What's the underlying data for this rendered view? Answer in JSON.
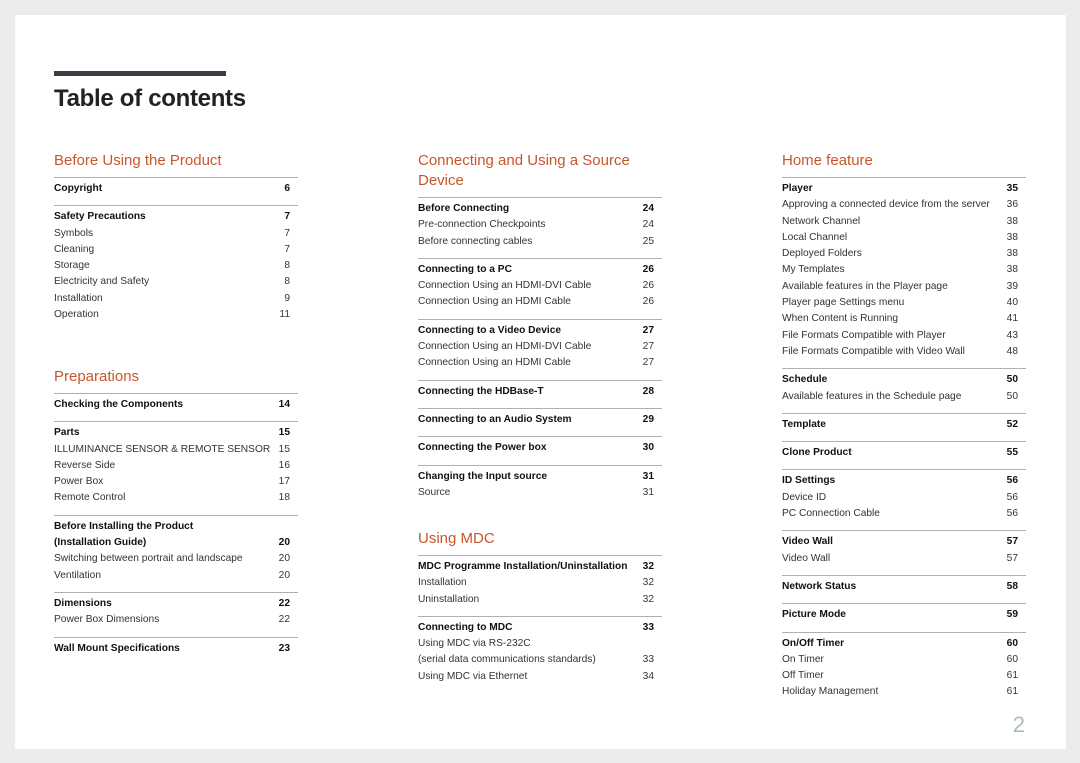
{
  "document": {
    "title": "Table of contents",
    "page_number": "2",
    "accent_color": "#c8562d"
  },
  "sections": [
    {
      "title": "Before Using the Product",
      "groups": [
        {
          "head": {
            "label": "Copyright",
            "page": "6"
          },
          "items": []
        },
        {
          "head": {
            "label": "Safety Precautions",
            "page": "7"
          },
          "items": [
            {
              "label": "Symbols",
              "page": "7"
            },
            {
              "label": "Cleaning",
              "page": "7"
            },
            {
              "label": "Storage",
              "page": "8"
            },
            {
              "label": "Electricity and Safety",
              "page": "8"
            },
            {
              "label": "Installation",
              "page": "9"
            },
            {
              "label": "Operation",
              "page": "11"
            }
          ]
        }
      ]
    },
    {
      "title": "Preparations",
      "groups": [
        {
          "head": {
            "label": "Checking the Components",
            "page": "14"
          },
          "items": []
        },
        {
          "head": {
            "label": "Parts",
            "page": "15"
          },
          "items": [
            {
              "label": "ILLUMINANCE SENSOR & REMOTE SENSOR",
              "page": "15"
            },
            {
              "label": "Reverse Side",
              "page": "16"
            },
            {
              "label": "Power Box",
              "page": "17"
            },
            {
              "label": "Remote Control",
              "page": "18"
            }
          ]
        },
        {
          "head": {
            "label": "Before Installing the Product\n(Installation Guide)",
            "page": "20"
          },
          "items": [
            {
              "label": "Switching between portrait and landscape",
              "page": "20"
            },
            {
              "label": "Ventilation",
              "page": "20"
            }
          ]
        },
        {
          "head": {
            "label": "Dimensions",
            "page": "22"
          },
          "items": [
            {
              "label": "Power Box Dimensions",
              "page": "22"
            }
          ]
        },
        {
          "head": {
            "label": "Wall Mount Specifications",
            "page": "23"
          },
          "items": []
        }
      ]
    },
    {
      "title": "Connecting and Using a Source Device",
      "groups": [
        {
          "head": {
            "label": "Before Connecting",
            "page": "24"
          },
          "items": [
            {
              "label": "Pre-connection Checkpoints",
              "page": "24"
            },
            {
              "label": "Before connecting cables",
              "page": "25"
            }
          ]
        },
        {
          "head": {
            "label": "Connecting to a PC",
            "page": "26"
          },
          "items": [
            {
              "label": "Connection Using an HDMI-DVI Cable",
              "page": "26"
            },
            {
              "label": "Connection Using an HDMI Cable",
              "page": "26"
            }
          ]
        },
        {
          "head": {
            "label": "Connecting to a Video Device",
            "page": "27"
          },
          "items": [
            {
              "label": "Connection Using an HDMI-DVI Cable",
              "page": "27"
            },
            {
              "label": "Connection Using an HDMI Cable",
              "page": "27"
            }
          ]
        },
        {
          "head": {
            "label": "Connecting the HDBase-T",
            "page": "28"
          },
          "items": []
        },
        {
          "head": {
            "label": "Connecting to an Audio System",
            "page": "29"
          },
          "items": []
        },
        {
          "head": {
            "label": "Connecting the Power box",
            "page": "30"
          },
          "items": []
        },
        {
          "head": {
            "label": "Changing the Input source",
            "page": "31"
          },
          "items": [
            {
              "label": "Source",
              "page": "31"
            }
          ]
        }
      ]
    },
    {
      "title": "Using MDC",
      "groups": [
        {
          "head": {
            "label": "MDC Programme Installation/Uninstallation",
            "page": "32"
          },
          "items": [
            {
              "label": "Installation",
              "page": "32"
            },
            {
              "label": "Uninstallation",
              "page": "32"
            }
          ]
        },
        {
          "head": {
            "label": "Connecting to MDC",
            "page": "33"
          },
          "items": [
            {
              "label": "Using MDC via RS-232C\n(serial data communications standards)",
              "page": "33"
            },
            {
              "label": "Using MDC via Ethernet",
              "page": "34"
            }
          ]
        }
      ]
    },
    {
      "title": "Home feature",
      "groups": [
        {
          "head": {
            "label": "Player",
            "page": "35"
          },
          "items": [
            {
              "label": "Approving a connected device from the server",
              "page": "36"
            },
            {
              "label": "Network Channel",
              "page": "38"
            },
            {
              "label": "Local Channel",
              "page": "38"
            },
            {
              "label": "Deployed Folders",
              "page": "38"
            },
            {
              "label": "My Templates",
              "page": "38"
            },
            {
              "label": "Available features in the Player page",
              "page": "39"
            },
            {
              "label": "Player page Settings menu",
              "page": "40"
            },
            {
              "label": "When Content is Running",
              "page": "41"
            },
            {
              "label": "File Formats Compatible with Player",
              "page": "43"
            },
            {
              "label": "File Formats Compatible with Video Wall",
              "page": "48"
            }
          ]
        },
        {
          "head": {
            "label": "Schedule",
            "page": "50"
          },
          "items": [
            {
              "label": "Available features in the Schedule page",
              "page": "50"
            }
          ]
        },
        {
          "head": {
            "label": "Template",
            "page": "52"
          },
          "items": []
        },
        {
          "head": {
            "label": "Clone Product",
            "page": "55"
          },
          "items": []
        },
        {
          "head": {
            "label": "ID Settings",
            "page": "56"
          },
          "items": [
            {
              "label": "Device ID",
              "page": "56"
            },
            {
              "label": "PC Connection Cable",
              "page": "56"
            }
          ]
        },
        {
          "head": {
            "label": "Video Wall",
            "page": "57"
          },
          "items": [
            {
              "label": "Video Wall",
              "page": "57"
            }
          ]
        },
        {
          "head": {
            "label": "Network Status",
            "page": "58"
          },
          "items": []
        },
        {
          "head": {
            "label": "Picture Mode",
            "page": "59"
          },
          "items": []
        },
        {
          "head": {
            "label": "On/Off Timer",
            "page": "60"
          },
          "items": [
            {
              "label": "On Timer",
              "page": "60"
            },
            {
              "label": "Off Timer",
              "page": "61"
            },
            {
              "label": "Holiday Management",
              "page": "61"
            }
          ]
        }
      ]
    }
  ]
}
